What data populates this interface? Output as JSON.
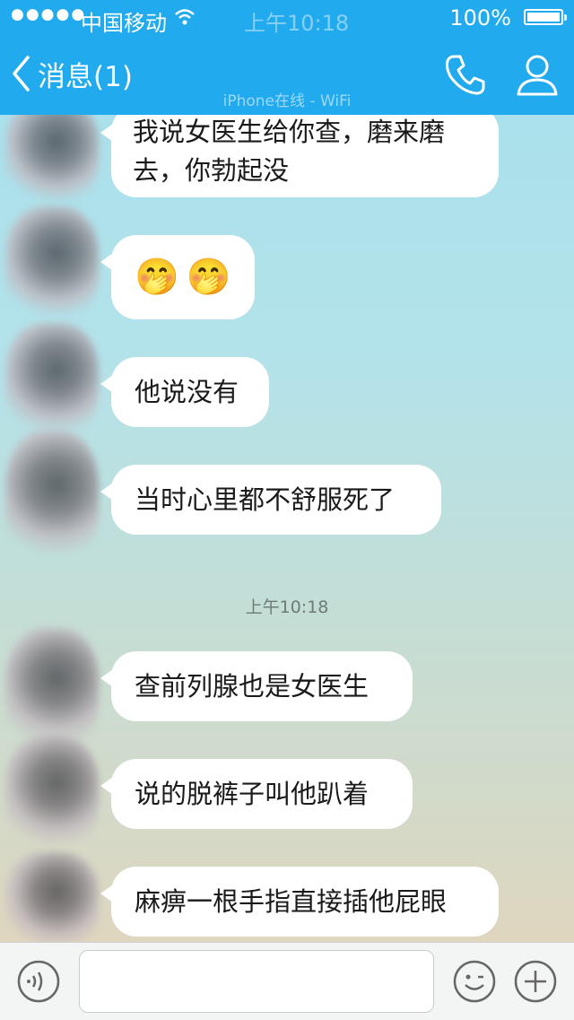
{
  "status_bar": {
    "signal": "●●●●●",
    "carrier": "中国移动",
    "time": "上午10:18",
    "battery": "100%"
  },
  "header": {
    "back_label": "消息(1)",
    "contact_name": "",
    "contact_status": "iPhone在线 - WiFi"
  },
  "messages": [
    {
      "text_line1": "我说女医生给你查，磨来磨",
      "text_line2": "去，你勃起没"
    },
    {
      "emoji": [
        "🤭",
        "🤭"
      ]
    },
    {
      "text": "他说没有"
    },
    {
      "text": "当时心里都不舒服死了"
    },
    {
      "timestamp": "上午10:18"
    },
    {
      "text": "查前列腺也是女医生"
    },
    {
      "text": "说的脱裤子叫他趴着"
    },
    {
      "text": "麻痹一根手指直接插他屁眼"
    }
  ],
  "input": {
    "value": "",
    "placeholder": ""
  },
  "colors": {
    "header": "#22aaee",
    "bubble": "#ffffff",
    "input_bar": "#f3f4f4"
  },
  "icons": [
    "back-chevron-icon",
    "phone-icon",
    "person-icon",
    "voice-icon",
    "emoji-face-icon",
    "plus-icon",
    "wifi-icon"
  ]
}
